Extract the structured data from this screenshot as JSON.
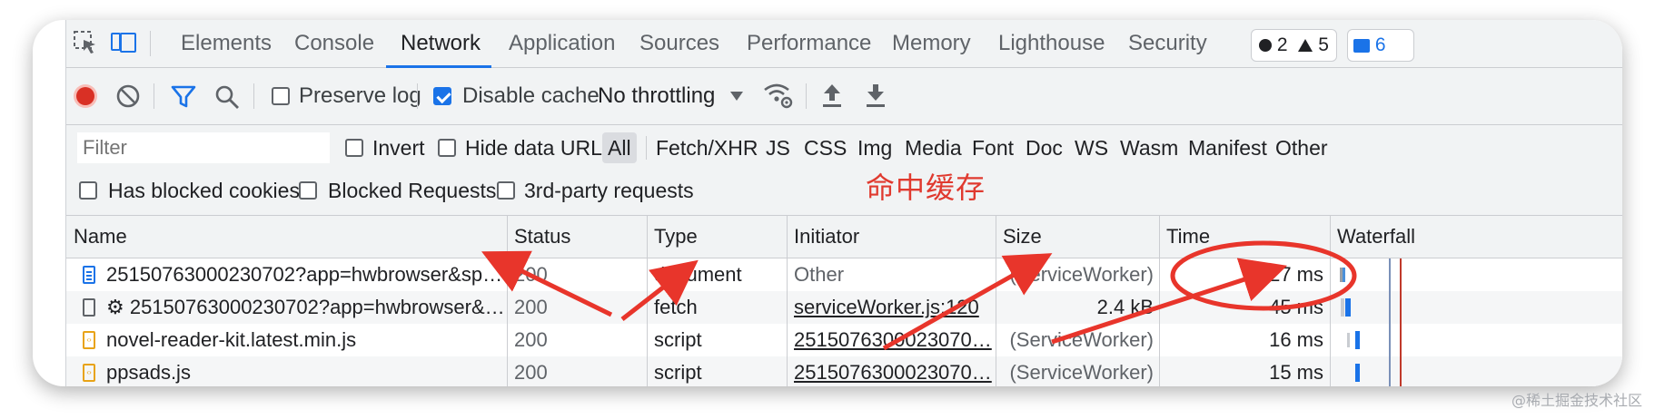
{
  "tabs": [
    {
      "label": "Elements",
      "active": false
    },
    {
      "label": "Console",
      "active": false
    },
    {
      "label": "Network",
      "active": true
    },
    {
      "label": "Application",
      "active": false
    },
    {
      "label": "Sources",
      "active": false
    },
    {
      "label": "Performance",
      "active": false
    },
    {
      "label": "Memory",
      "active": false
    },
    {
      "label": "Lighthouse",
      "active": false
    },
    {
      "label": "Security",
      "active": false
    }
  ],
  "badges": {
    "errors": "2",
    "warnings": "5",
    "messages": "6"
  },
  "toolbar": {
    "preserve_log_label": "Preserve log",
    "preserve_log_checked": false,
    "disable_cache_label": "Disable cache",
    "disable_cache_checked": true,
    "throttling_value": "No throttling"
  },
  "filter": {
    "placeholder": "Filter",
    "invert_label": "Invert",
    "hide_data_urls_label": "Hide data URLs",
    "types": [
      "All",
      "Fetch/XHR",
      "JS",
      "CSS",
      "Img",
      "Media",
      "Font",
      "Doc",
      "WS",
      "Wasm",
      "Manifest",
      "Other"
    ],
    "has_blocked_cookies_label": "Has blocked cookies",
    "blocked_requests_label": "Blocked Requests",
    "third_party_label": "3rd-party requests"
  },
  "annotation": "命中缓存",
  "table": {
    "columns": [
      "Name",
      "Status",
      "Type",
      "Initiator",
      "Size",
      "Time",
      "Waterfall"
    ],
    "rows": [
      {
        "name": "25150763000230702?app=hwbrowser&spm…",
        "status": "200",
        "type": "document",
        "initiator": "Other",
        "size": "(ServiceWorker)",
        "time": "27 ms",
        "icon": "document-icon"
      },
      {
        "name": "⚙ 25150763000230702?app=hwbrowser&sp…",
        "status": "200",
        "type": "fetch",
        "initiator": "serviceWorker.js:120",
        "size": "2.4 kB",
        "time": "45 ms",
        "icon": "fetch-icon"
      },
      {
        "name": "novel-reader-kit.latest.min.js",
        "status": "200",
        "type": "script",
        "initiator": "2515076300023070…",
        "size": "(ServiceWorker)",
        "time": "16 ms",
        "icon": "script-icon"
      },
      {
        "name": "ppsads.js",
        "status": "200",
        "type": "script",
        "initiator": "2515076300023070…",
        "size": "(ServiceWorker)",
        "time": "15 ms",
        "icon": "script-icon"
      }
    ]
  },
  "colors": {
    "accent": "#1a73e8",
    "record": "#d93025",
    "annotation": "#e03a2f"
  },
  "watermark": "@稀土掘金技术社区"
}
